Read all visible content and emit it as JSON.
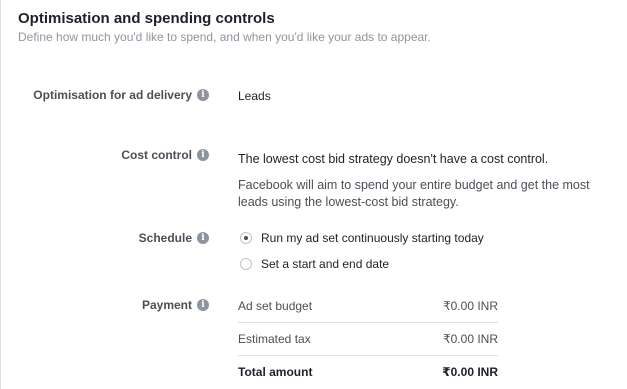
{
  "section": {
    "title": "Optimisation and spending controls",
    "subtitle": "Define how much you'd like to spend, and when you'd like your ads to appear."
  },
  "optimisation": {
    "label": "Optimisation for ad delivery",
    "value": "Leads"
  },
  "cost_control": {
    "label": "Cost control",
    "main": "The lowest cost bid strategy doesn't have a cost control.",
    "description": "Facebook will aim to spend your entire budget and get the most leads using the lowest-cost bid strategy."
  },
  "schedule": {
    "label": "Schedule",
    "options": [
      {
        "label": "Run my ad set continuously starting today",
        "selected": true
      },
      {
        "label": "Set a start and end date",
        "selected": false
      }
    ]
  },
  "payment": {
    "label": "Payment",
    "rows": [
      {
        "label": "Ad set budget",
        "amount": "₹0.00 INR"
      },
      {
        "label": "Estimated tax",
        "amount": "₹0.00 INR"
      },
      {
        "label": "Total amount",
        "amount": "₹0.00 INR"
      }
    ]
  },
  "icons": {
    "info": "info-icon",
    "info_glyph": "i"
  }
}
